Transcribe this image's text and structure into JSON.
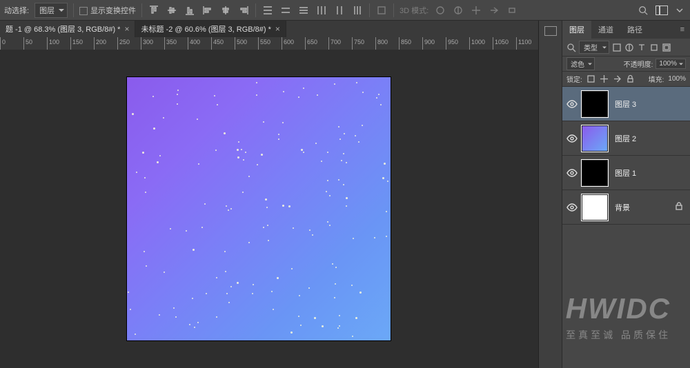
{
  "optbar": {
    "autoselect_label": "动选择:",
    "autoselect_value": "图层",
    "show_controls": "显示变换控件",
    "mode3d_label": "3D 模式:"
  },
  "tabs": [
    {
      "title": "题 -1 @ 68.3% (图层 3, RGB/8#) *"
    },
    {
      "title": "未标题 -2 @ 60.6% (图层 3, RGB/8#) *"
    }
  ],
  "ruler_ticks": [
    0,
    50,
    100,
    150,
    200,
    250,
    300,
    350,
    400,
    450,
    500,
    550,
    600,
    650,
    700,
    750,
    800,
    850,
    900,
    950,
    1000,
    1050,
    1100
  ],
  "panel": {
    "tabs": {
      "layers": "图层",
      "channels": "通道",
      "paths": "路径"
    },
    "filter_label": "类型",
    "blend_mode": "滤色",
    "opacity_label": "不透明度:",
    "opacity_value": "100%",
    "lock_label": "锁定:",
    "fill_label": "填充:",
    "fill_value": "100%"
  },
  "layers": [
    {
      "name": "图层 3",
      "thumb": "black",
      "selected": true,
      "locked": false
    },
    {
      "name": "图层 2",
      "thumb": "grad",
      "selected": false,
      "locked": false
    },
    {
      "name": "图层 1",
      "thumb": "black",
      "selected": false,
      "locked": false
    },
    {
      "name": "背景",
      "thumb": "white",
      "selected": false,
      "locked": true
    }
  ],
  "watermark": {
    "big": "HWIDC",
    "small": "至真至诚 品质保住"
  }
}
